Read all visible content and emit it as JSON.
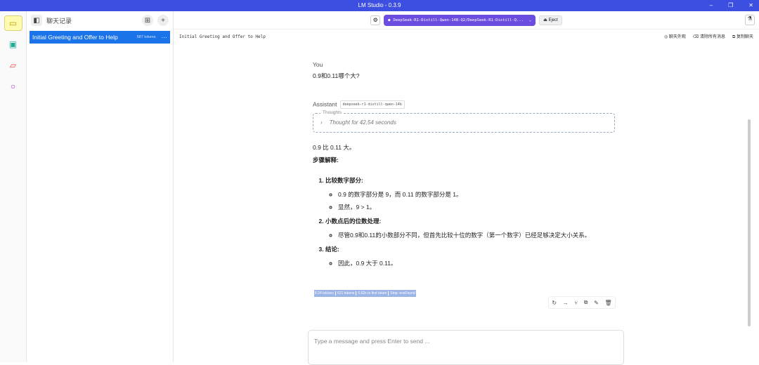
{
  "window": {
    "title": "LM Studio - 0.3.9",
    "controls": [
      "–",
      "❐",
      "✕"
    ]
  },
  "sidebar": {
    "title": "聊天记录",
    "chats": [
      {
        "title": "Initial Greeting and Offer to Help",
        "tokens": "587 tokens"
      }
    ]
  },
  "topbar": {
    "model": "DeepSeek-R1-Distill-Qwen-14B-Q2/DeepSeek-R1-Distill-Q...",
    "eject": "Eject"
  },
  "subbar": {
    "chat_title": "Initial Greeting and Offer to Help",
    "actions": [
      "聊天外观",
      "清除所有消息",
      "复制聊天"
    ]
  },
  "conversation": {
    "user_label": "You",
    "user_message": "0.9和0.11哪个大?",
    "assistant_label": "Assistant",
    "assistant_model": "deepseek-r1-distill-qwen-14b",
    "thoughts_label": "Thoughts",
    "thoughts_summary": "Thought for 42.54 seconds",
    "answer": "0.9 比 0.11 大。",
    "steps_heading": "步骤解释:",
    "steps": [
      {
        "title": "比较数字部分:",
        "bullets": [
          "0.9 的数字部分是 9，而 0.11 的数字部分是 1。",
          "显然，9 > 1。"
        ]
      },
      {
        "title": "小数点后的位数处理:",
        "bullets": [
          "尽管0.9和0.11的小数部分不同，但首先比较十位的数字（第一个数字）已经足够决定大小关系。"
        ]
      },
      {
        "title": "结论:",
        "bullets": [
          "因此，0.9 大于 0.11。"
        ]
      }
    ],
    "stats": [
      "8.24 tok/sec",
      "521 tokens",
      "0.62s to first token",
      "Stop: eosFound"
    ]
  },
  "input": {
    "placeholder": "Type a message and press Enter to send ..."
  }
}
